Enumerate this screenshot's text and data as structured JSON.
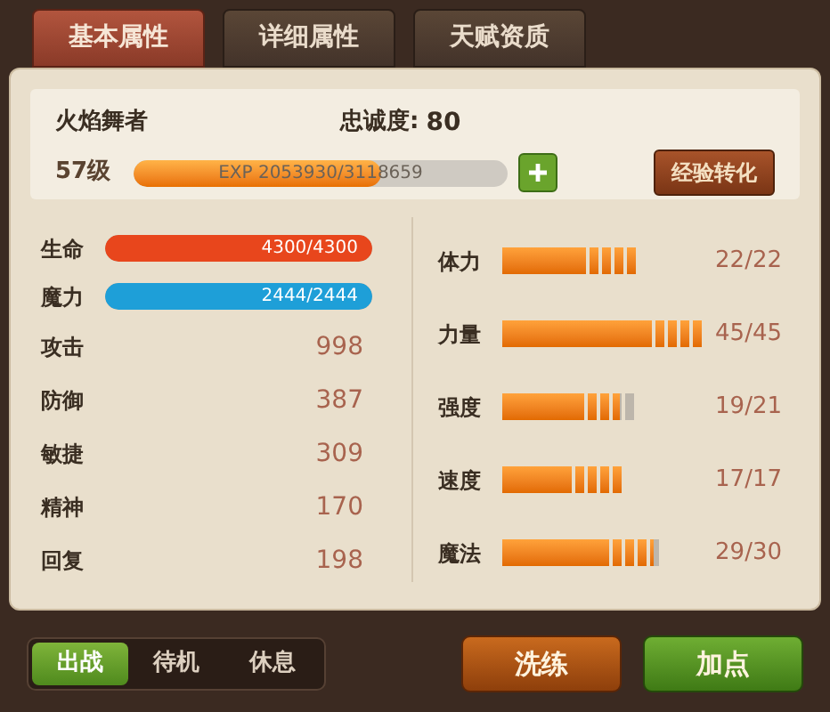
{
  "tabs": [
    {
      "label": "基本属性",
      "selected": true
    },
    {
      "label": "详细属性",
      "selected": false
    },
    {
      "label": "天赋资质",
      "selected": false
    }
  ],
  "header": {
    "name": "火焰舞者",
    "loyalty_label": "忠诚度:",
    "loyalty": "80",
    "level_label": "57级",
    "exp": {
      "text": "EXP 2053930/3118659",
      "level": 0.66
    },
    "convert_button": "经验转化"
  },
  "gauges": [
    {
      "label": "生命",
      "reading": "4300/4300",
      "level": 1,
      "color": "#e8461c"
    },
    {
      "label": "魔力",
      "reading": "2444/2444",
      "level": 1,
      "color": "#1e9fd8"
    }
  ],
  "stats": [
    {
      "label": "攻击",
      "value": "998"
    },
    {
      "label": "防御",
      "value": "387"
    },
    {
      "label": "敏捷",
      "value": "309"
    },
    {
      "label": "精神",
      "value": "170"
    },
    {
      "label": "回复",
      "value": "198"
    }
  ],
  "attributes": [
    {
      "label": "体力",
      "reading": "22/22",
      "level": 1
    },
    {
      "label": "力量",
      "reading": "45/45",
      "level": 1
    },
    {
      "label": "强度",
      "reading": "19/21",
      "level": 0.9
    },
    {
      "label": "速度",
      "reading": "17/17",
      "level": 1
    },
    {
      "label": "魔法",
      "reading": "29/30",
      "level": 0.97
    }
  ],
  "modes": [
    {
      "label": "出战",
      "selected": true
    },
    {
      "label": "待机",
      "selected": false
    },
    {
      "label": "休息",
      "selected": false
    }
  ],
  "buttons": [
    {
      "label": "洗练",
      "kind": "orange"
    },
    {
      "label": "加点",
      "kind": "green"
    }
  ]
}
